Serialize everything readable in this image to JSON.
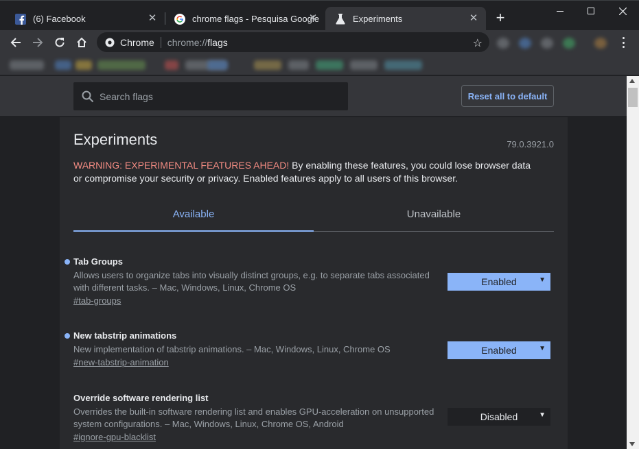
{
  "tabs": [
    {
      "title": "(6) Facebook",
      "icon": "facebook-icon"
    },
    {
      "title": "chrome flags - Pesquisa Google",
      "icon": "google-icon"
    },
    {
      "title": "Experiments",
      "icon": "flask-icon",
      "active": true
    }
  ],
  "toolbar": {
    "chip": "Chrome",
    "url_scheme": "chrome://",
    "url_host": "flags"
  },
  "header": {
    "search_placeholder": "Search flags",
    "reset_label": "Reset all to default"
  },
  "page": {
    "title": "Experiments",
    "version": "79.0.3921.0",
    "warning_red": "WARNING: EXPERIMENTAL FEATURES AHEAD!",
    "warning_text": " By enabling these features, you could lose browser data or compromise your security or privacy. Enabled features apply to all users of this browser.",
    "tab_available": "Available",
    "tab_unavailable": "Unavailable"
  },
  "flags": [
    {
      "name": "Tab Groups",
      "description": "Allows users to organize tabs into visually distinct groups, e.g. to separate tabs associated with different tasks. – Mac, Windows, Linux, Chrome OS",
      "id": "#tab-groups",
      "value": "Enabled",
      "modified": true
    },
    {
      "name": "New tabstrip animations",
      "description": "New implementation of tabstrip animations. – Mac, Windows, Linux, Chrome OS",
      "id": "#new-tabstrip-animation",
      "value": "Enabled",
      "modified": true
    },
    {
      "name": "Override software rendering list",
      "description": "Overrides the built-in software rendering list and enables GPU-acceleration on unsupported system configurations. – Mac, Windows, Linux, Chrome OS, Android",
      "id": "#ignore-gpu-blacklist",
      "value": "Disabled",
      "modified": false
    }
  ],
  "colors": {
    "accent": "#8ab4f8",
    "warning": "#f28b82",
    "background": "#202124",
    "surface": "#292a2d",
    "toolbar": "#35363a"
  }
}
